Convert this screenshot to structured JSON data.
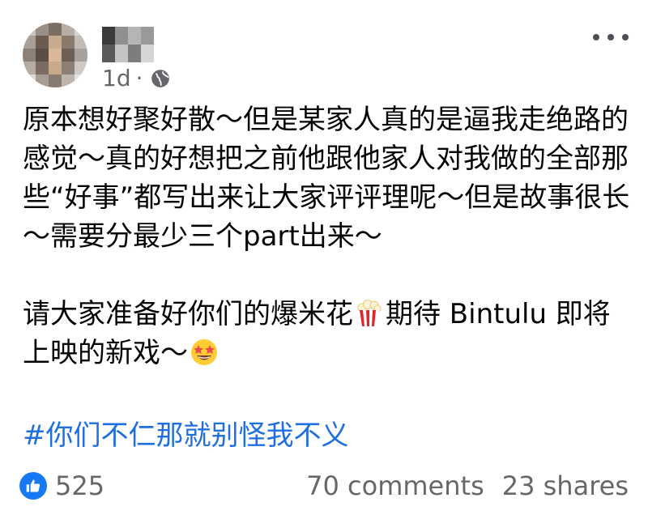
{
  "post": {
    "meta": {
      "time": "1d",
      "separator": "·",
      "audience_icon": "globe-icon"
    },
    "menu_icon": "more-dots-icon",
    "paragraphs": [
      "原本想好聚好散～但是某家人真的是逼我走绝路的感觉～真的好想把之前他跟他家人对我做的全部那些“好事”都写出来让大家评评理呢～但是故事很长～需要分最少三个part出来～",
      {
        "part1": "请大家准备好你们的爆米花",
        "emoji1": "popcorn-emoji",
        "part2": "期待 Bintulu 即将上映的新戏～",
        "emoji2": "star-struck-emoji"
      }
    ],
    "hashtag": "#你们不仁那就别怪我不义",
    "stats": {
      "reaction_icon": "like-icon",
      "reactions": "525",
      "comments": "70 comments",
      "shares": "23 shares"
    },
    "colors": {
      "text": "#050505",
      "secondary": "#65676b",
      "link": "#1f6fe0",
      "like_blue": "#1877f2"
    }
  }
}
